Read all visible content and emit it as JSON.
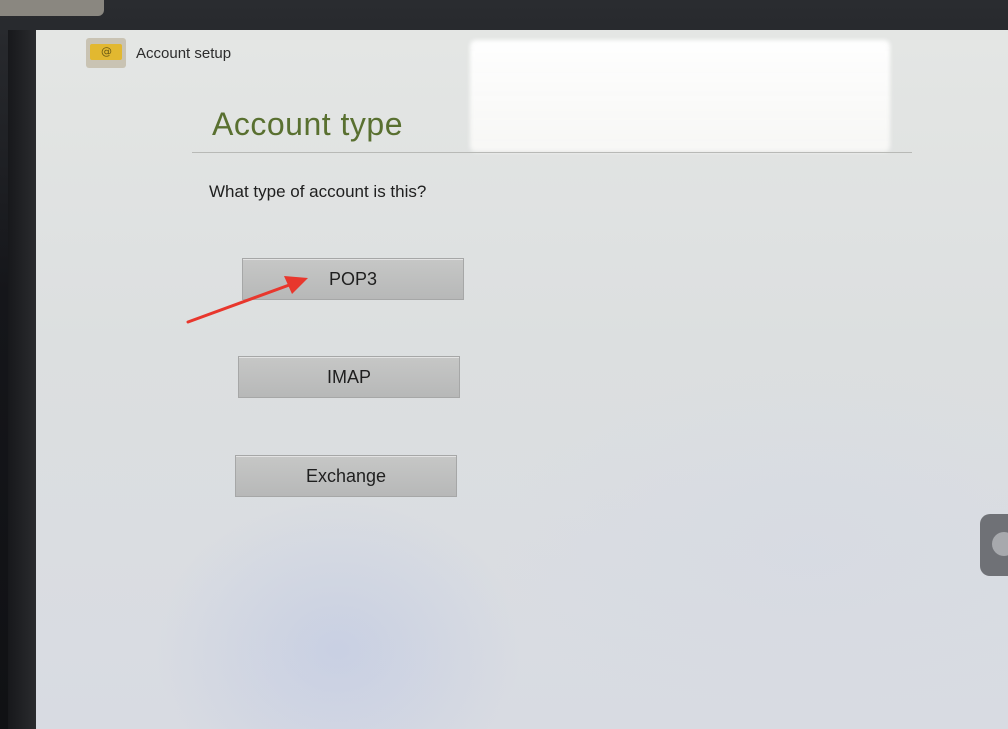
{
  "action_bar": {
    "icon": "mail-envelope-icon",
    "title": "Account setup"
  },
  "page": {
    "title": "Account type",
    "question": "What type of account is this?"
  },
  "options": [
    {
      "label": "POP3"
    },
    {
      "label": "IMAP"
    },
    {
      "label": "Exchange"
    }
  ],
  "colors": {
    "title_green": "#597030",
    "button_bg": "#bebfbf",
    "annotation_red": "#e8372d",
    "app_icon_yellow": "#e2b830"
  },
  "annotation": {
    "icon": "red-arrow-pointer-icon",
    "target": "POP3"
  }
}
